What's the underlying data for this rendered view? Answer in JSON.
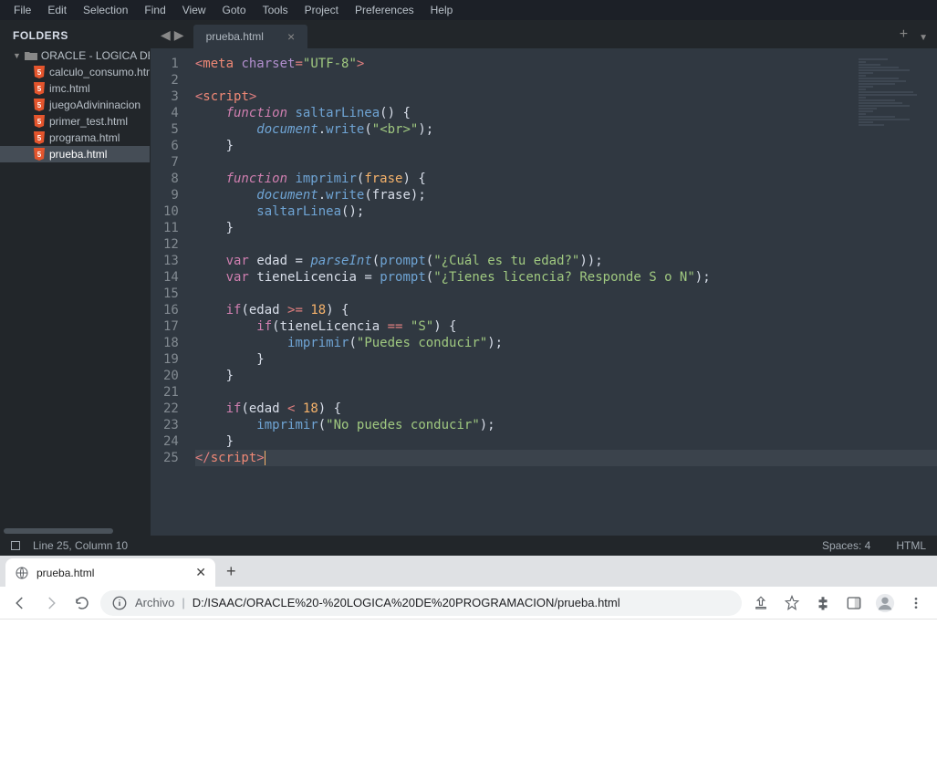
{
  "menu": {
    "items": [
      "File",
      "Edit",
      "Selection",
      "Find",
      "View",
      "Goto",
      "Tools",
      "Project",
      "Preferences",
      "Help"
    ]
  },
  "sidebar": {
    "title": "FOLDERS",
    "root": "ORACLE - LOGICA DE",
    "files": [
      "calculo_consumo.html",
      "imc.html",
      "juegoAdivininacion",
      "primer_test.html",
      "programa.html",
      "prueba.html"
    ],
    "activeFile": "prueba.html"
  },
  "tab": {
    "title": "prueba.html"
  },
  "code": {
    "lines": 25,
    "tokens": [
      [
        [
          "<",
          "op"
        ],
        [
          "meta",
          "tag"
        ],
        [
          " ",
          ""
        ],
        [
          "charset",
          "attr"
        ],
        [
          "=",
          "op"
        ],
        [
          "\"UTF-8\"",
          "str"
        ],
        [
          ">",
          "op"
        ]
      ],
      [],
      [
        [
          "<",
          "op"
        ],
        [
          "script",
          "tag"
        ],
        [
          ">",
          "op"
        ]
      ],
      [
        [
          "    ",
          ""
        ],
        [
          "function",
          "kw"
        ],
        [
          " ",
          ""
        ],
        [
          "saltarLinea",
          "fn"
        ],
        [
          "() {",
          ""
        ]
      ],
      [
        [
          "        ",
          ""
        ],
        [
          "document",
          "builtin"
        ],
        [
          ".",
          ""
        ],
        [
          "write",
          "fn"
        ],
        [
          "(",
          ""
        ],
        [
          "\"<br>\"",
          "str"
        ],
        [
          ");",
          ""
        ]
      ],
      [
        [
          "    }",
          ""
        ]
      ],
      [],
      [
        [
          "    ",
          ""
        ],
        [
          "function",
          "kw"
        ],
        [
          " ",
          ""
        ],
        [
          "imprimir",
          "fn"
        ],
        [
          "(",
          ""
        ],
        [
          "frase",
          "param"
        ],
        [
          ") {",
          ""
        ]
      ],
      [
        [
          "        ",
          ""
        ],
        [
          "document",
          "builtin"
        ],
        [
          ".",
          ""
        ],
        [
          "write",
          "fn"
        ],
        [
          "(",
          ""
        ],
        [
          "frase",
          "var"
        ],
        [
          ");",
          ""
        ]
      ],
      [
        [
          "        ",
          ""
        ],
        [
          "saltarLinea",
          "fn"
        ],
        [
          "();",
          ""
        ]
      ],
      [
        [
          "    }",
          ""
        ]
      ],
      [],
      [
        [
          "    ",
          ""
        ],
        [
          "var",
          "kwb"
        ],
        [
          " ",
          ""
        ],
        [
          "edad",
          "var"
        ],
        [
          " = ",
          ""
        ],
        [
          "parseInt",
          "builtin"
        ],
        [
          "(",
          ""
        ],
        [
          "prompt",
          "fn"
        ],
        [
          "(",
          ""
        ],
        [
          "\"¿Cuál es tu edad?\"",
          "str"
        ],
        [
          "));",
          ""
        ]
      ],
      [
        [
          "    ",
          ""
        ],
        [
          "var",
          "kwb"
        ],
        [
          " ",
          ""
        ],
        [
          "tieneLicencia",
          "var"
        ],
        [
          " = ",
          ""
        ],
        [
          "prompt",
          "fn"
        ],
        [
          "(",
          ""
        ],
        [
          "\"¿Tienes licencia? Responde S o N\"",
          "str"
        ],
        [
          ");",
          ""
        ]
      ],
      [],
      [
        [
          "    ",
          ""
        ],
        [
          "if",
          "kwb"
        ],
        [
          "(",
          ""
        ],
        [
          "edad",
          "var"
        ],
        [
          " ",
          ""
        ],
        [
          ">=",
          "op"
        ],
        [
          " ",
          ""
        ],
        [
          "18",
          "num"
        ],
        [
          ") {",
          ""
        ]
      ],
      [
        [
          "        ",
          ""
        ],
        [
          "if",
          "kwb"
        ],
        [
          "(",
          ""
        ],
        [
          "tieneLicencia",
          "var"
        ],
        [
          " ",
          ""
        ],
        [
          "==",
          "op"
        ],
        [
          " ",
          ""
        ],
        [
          "\"S\"",
          "str"
        ],
        [
          ") {",
          ""
        ]
      ],
      [
        [
          "            ",
          ""
        ],
        [
          "imprimir",
          "fn"
        ],
        [
          "(",
          ""
        ],
        [
          "\"Puedes conducir\"",
          "str"
        ],
        [
          ");",
          ""
        ]
      ],
      [
        [
          "        }",
          ""
        ]
      ],
      [
        [
          "    }",
          ""
        ]
      ],
      [],
      [
        [
          "    ",
          ""
        ],
        [
          "if",
          "kwb"
        ],
        [
          "(",
          ""
        ],
        [
          "edad",
          "var"
        ],
        [
          " ",
          ""
        ],
        [
          "<",
          "op"
        ],
        [
          " ",
          ""
        ],
        [
          "18",
          "num"
        ],
        [
          ") {",
          ""
        ]
      ],
      [
        [
          "        ",
          ""
        ],
        [
          "imprimir",
          "fn"
        ],
        [
          "(",
          ""
        ],
        [
          "\"No puedes conducir\"",
          "str"
        ],
        [
          ");",
          ""
        ]
      ],
      [
        [
          "    }",
          ""
        ]
      ],
      [
        [
          "</",
          "op"
        ],
        [
          "script",
          "tag"
        ],
        [
          ">",
          "op"
        ]
      ]
    ],
    "highlightLine": 25
  },
  "status": {
    "cursor": "Line 25, Column 10",
    "spaces": "Spaces: 4",
    "syntax": "HTML"
  },
  "browser": {
    "tabTitle": "prueba.html",
    "protocol": "Archivo",
    "url": "D:/ISAAC/ORACLE%20-%20LOGICA%20DE%20PROGRAMACION/prueba.html"
  }
}
